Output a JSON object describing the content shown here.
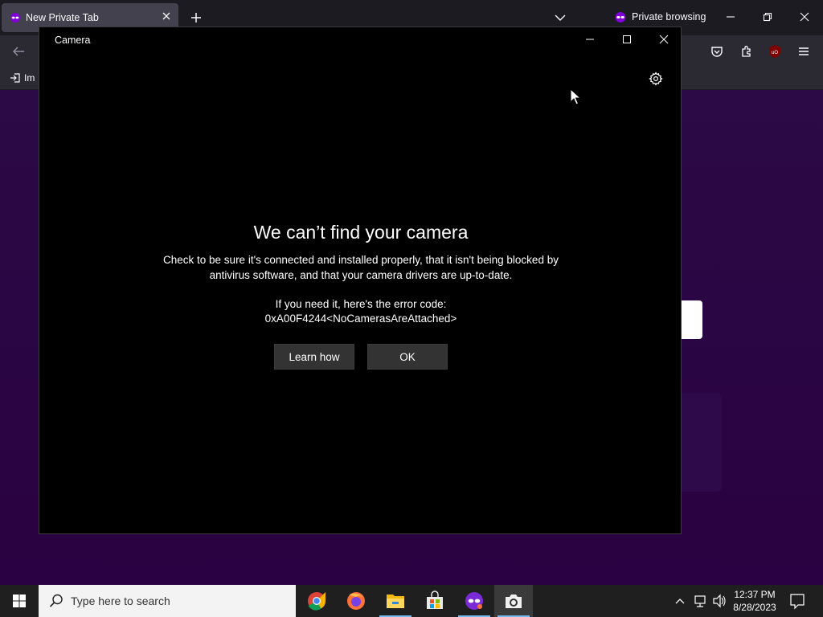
{
  "browser": {
    "tab_title": "New Private Tab",
    "private_label": "Private browsing",
    "bookmark_import_label": "Im",
    "ublock_badge": "uO"
  },
  "camera": {
    "window_title": "Camera",
    "error_title": "We can’t find your camera",
    "error_body": "Check to be sure it's connected and installed properly, that it isn't being blocked by antivirus software, and that your camera drivers are up-to-date.",
    "error_code_label": "If you need it, here's the error code:",
    "error_code": "0xA00F4244<NoCamerasAreAttached>",
    "learn_how_label": "Learn how",
    "ok_label": "OK"
  },
  "taskbar": {
    "search_placeholder": "Type here to search",
    "time": "12:37 PM",
    "date": "8/28/2023",
    "apps": [
      "chrome-icon",
      "firefox-icon",
      "file-explorer-icon",
      "microsoft-store-icon",
      "firefox-private-icon",
      "camera-icon"
    ]
  },
  "colors": {
    "private_purple": "#8000d7",
    "newtab_bg": "#2b0a45",
    "taskbar_bg": "#1f1f1f",
    "accent_blue": "#76b9ed"
  }
}
